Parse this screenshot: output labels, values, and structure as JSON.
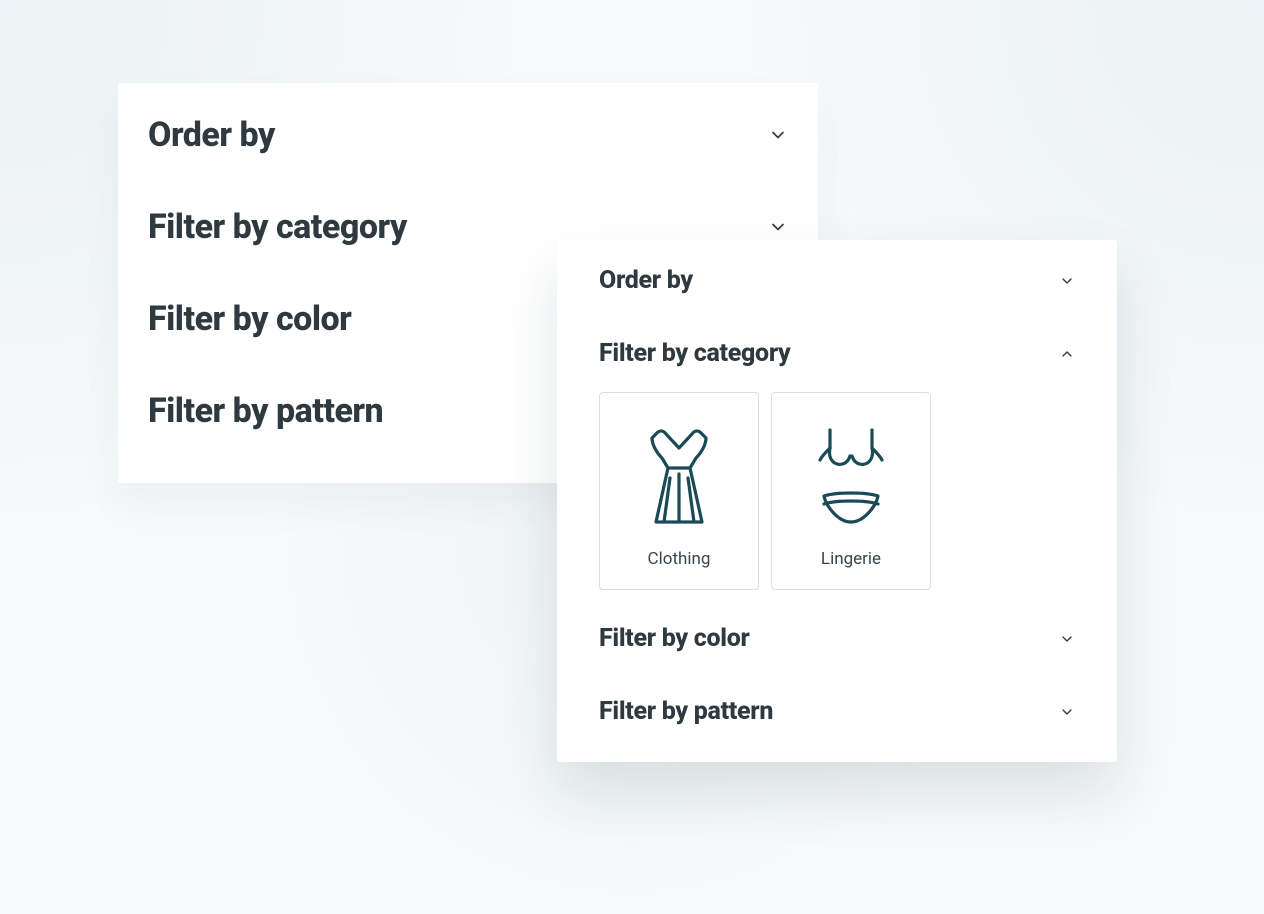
{
  "filters_back": {
    "order_by": "Order by",
    "category": "Filter by category",
    "color": "Filter by color",
    "pattern": "Filter by pattern"
  },
  "filters_front": {
    "order_by": "Order by",
    "category": "Filter by category",
    "color": "Filter by color",
    "pattern": "Filter by pattern",
    "category_expanded": true,
    "category_options": {
      "clothing": "Clothing",
      "lingerie": "Lingerie"
    }
  }
}
